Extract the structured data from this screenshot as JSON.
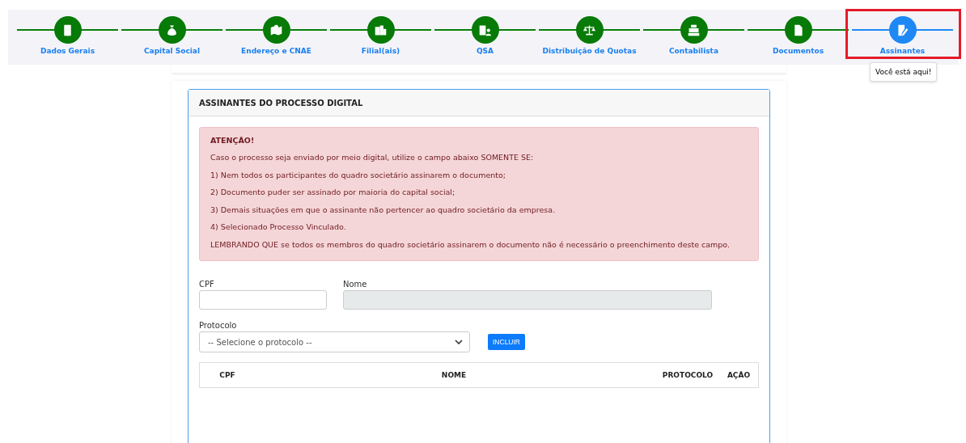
{
  "steps": [
    {
      "label": "Dados Gerais",
      "selected": false
    },
    {
      "label": "Capital Social",
      "selected": false
    },
    {
      "label": "Endereço e CNAE",
      "selected": false
    },
    {
      "label": "Filial(ais)",
      "selected": false
    },
    {
      "label": "QSA",
      "selected": false
    },
    {
      "label": "Distribuição de Quotas",
      "selected": false
    },
    {
      "label": "Contabilista",
      "selected": false
    },
    {
      "label": "Documentos",
      "selected": false
    },
    {
      "label": "Assinantes",
      "selected": true
    }
  ],
  "tooltip": "Você está aqui!",
  "panel": {
    "title": "ASSINANTES DO PROCESSO DIGITAL",
    "alert": {
      "heading": "ATENÇÃO!",
      "lines": [
        "Caso o processo seja enviado por meio digital, utilize o campo abaixo SOMENTE SE:",
        "1) Nem todos os participantes do quadro societário assinarem o documento;",
        "2) Documento puder ser assinado por maioria do capital social;",
        "3) Demais situações em que o assinante não pertencer ao quadro societário da empresa.",
        "4) Selecionado Processo Vinculado.",
        "LEMBRANDO QUE se todos os membros do quadro societário assinarem o documento não é necessário o preenchimento deste campo."
      ]
    },
    "form": {
      "cpf_label": "CPF",
      "nome_label": "Nome",
      "nome_disabled": true,
      "protocolo_label": "Protocolo",
      "protocolo_value": "-- Selecione o protocolo --",
      "button": "INCLUIR"
    },
    "table": {
      "columns": [
        "CPF",
        "NOME",
        "PROTOCOLO",
        "AÇÃO"
      ]
    }
  }
}
